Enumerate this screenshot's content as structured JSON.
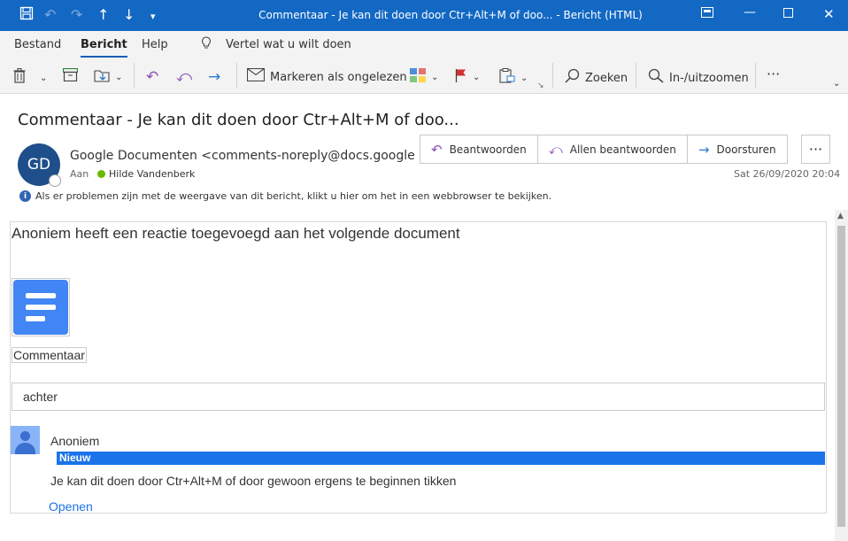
{
  "window": {
    "title": "Commentaar - Je kan dit doen door Ctr+Alt+M of doo...  -  Bericht (HTML)"
  },
  "ribbon": {
    "tabs": [
      {
        "label": "Bestand"
      },
      {
        "label": "Bericht",
        "active": true
      },
      {
        "label": "Help"
      }
    ],
    "tell_me": "Vertel wat u wilt doen"
  },
  "toolbar": {
    "mark_unread": "Markeren als ongelezen",
    "search": "Zoeken",
    "zoom": "In-/uitzoomen"
  },
  "message": {
    "subject": "Commentaar - Je kan dit doen door Ctr+Alt+M of doo...",
    "avatar_initials": "GD",
    "sender": "Google Documenten <comments-noreply@docs.google",
    "to_label": "Aan",
    "to_name": "Hilde Vandenberk",
    "date": "Sat 26/09/2020 20:04",
    "info_bar": "Als er problemen zijn met de weergave van dit bericht, klikt u hier om het in een webbrowser te bekijken.",
    "actions": {
      "reply": "Beantwoorden",
      "reply_all": "Allen beantwoorden",
      "forward": "Doorsturen"
    }
  },
  "email_body": {
    "headline": "Anoniem heeft een reactie toegevoegd aan het volgende document",
    "doc_type_label": "Commentaar",
    "quoted_text": "achter",
    "comment_author": "Anoniem",
    "new_badge": "Nieuw",
    "comment_text": "Je kan dit doen door Ctr+Alt+M of door gewoon ergens te beginnen tikken",
    "open_link": "Openen"
  },
  "colors": {
    "titlebar": "#1268c3",
    "accent_blue": "#1a73e8",
    "docs_blue": "#4285f4"
  }
}
